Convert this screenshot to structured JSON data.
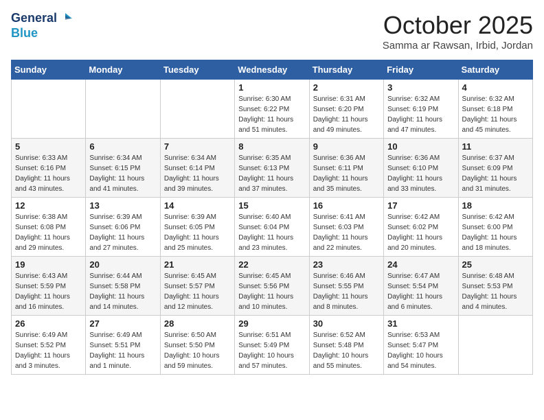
{
  "header": {
    "logo_line1": "General",
    "logo_line2": "Blue",
    "month_title": "October 2025",
    "location": "Samma ar Rawsan, Irbid, Jordan"
  },
  "weekdays": [
    "Sunday",
    "Monday",
    "Tuesday",
    "Wednesday",
    "Thursday",
    "Friday",
    "Saturday"
  ],
  "weeks": [
    [
      {
        "day": "",
        "info": ""
      },
      {
        "day": "",
        "info": ""
      },
      {
        "day": "",
        "info": ""
      },
      {
        "day": "1",
        "info": "Sunrise: 6:30 AM\nSunset: 6:22 PM\nDaylight: 11 hours\nand 51 minutes."
      },
      {
        "day": "2",
        "info": "Sunrise: 6:31 AM\nSunset: 6:20 PM\nDaylight: 11 hours\nand 49 minutes."
      },
      {
        "day": "3",
        "info": "Sunrise: 6:32 AM\nSunset: 6:19 PM\nDaylight: 11 hours\nand 47 minutes."
      },
      {
        "day": "4",
        "info": "Sunrise: 6:32 AM\nSunset: 6:18 PM\nDaylight: 11 hours\nand 45 minutes."
      }
    ],
    [
      {
        "day": "5",
        "info": "Sunrise: 6:33 AM\nSunset: 6:16 PM\nDaylight: 11 hours\nand 43 minutes."
      },
      {
        "day": "6",
        "info": "Sunrise: 6:34 AM\nSunset: 6:15 PM\nDaylight: 11 hours\nand 41 minutes."
      },
      {
        "day": "7",
        "info": "Sunrise: 6:34 AM\nSunset: 6:14 PM\nDaylight: 11 hours\nand 39 minutes."
      },
      {
        "day": "8",
        "info": "Sunrise: 6:35 AM\nSunset: 6:13 PM\nDaylight: 11 hours\nand 37 minutes."
      },
      {
        "day": "9",
        "info": "Sunrise: 6:36 AM\nSunset: 6:11 PM\nDaylight: 11 hours\nand 35 minutes."
      },
      {
        "day": "10",
        "info": "Sunrise: 6:36 AM\nSunset: 6:10 PM\nDaylight: 11 hours\nand 33 minutes."
      },
      {
        "day": "11",
        "info": "Sunrise: 6:37 AM\nSunset: 6:09 PM\nDaylight: 11 hours\nand 31 minutes."
      }
    ],
    [
      {
        "day": "12",
        "info": "Sunrise: 6:38 AM\nSunset: 6:08 PM\nDaylight: 11 hours\nand 29 minutes."
      },
      {
        "day": "13",
        "info": "Sunrise: 6:39 AM\nSunset: 6:06 PM\nDaylight: 11 hours\nand 27 minutes."
      },
      {
        "day": "14",
        "info": "Sunrise: 6:39 AM\nSunset: 6:05 PM\nDaylight: 11 hours\nand 25 minutes."
      },
      {
        "day": "15",
        "info": "Sunrise: 6:40 AM\nSunset: 6:04 PM\nDaylight: 11 hours\nand 23 minutes."
      },
      {
        "day": "16",
        "info": "Sunrise: 6:41 AM\nSunset: 6:03 PM\nDaylight: 11 hours\nand 22 minutes."
      },
      {
        "day": "17",
        "info": "Sunrise: 6:42 AM\nSunset: 6:02 PM\nDaylight: 11 hours\nand 20 minutes."
      },
      {
        "day": "18",
        "info": "Sunrise: 6:42 AM\nSunset: 6:00 PM\nDaylight: 11 hours\nand 18 minutes."
      }
    ],
    [
      {
        "day": "19",
        "info": "Sunrise: 6:43 AM\nSunset: 5:59 PM\nDaylight: 11 hours\nand 16 minutes."
      },
      {
        "day": "20",
        "info": "Sunrise: 6:44 AM\nSunset: 5:58 PM\nDaylight: 11 hours\nand 14 minutes."
      },
      {
        "day": "21",
        "info": "Sunrise: 6:45 AM\nSunset: 5:57 PM\nDaylight: 11 hours\nand 12 minutes."
      },
      {
        "day": "22",
        "info": "Sunrise: 6:45 AM\nSunset: 5:56 PM\nDaylight: 11 hours\nand 10 minutes."
      },
      {
        "day": "23",
        "info": "Sunrise: 6:46 AM\nSunset: 5:55 PM\nDaylight: 11 hours\nand 8 minutes."
      },
      {
        "day": "24",
        "info": "Sunrise: 6:47 AM\nSunset: 5:54 PM\nDaylight: 11 hours\nand 6 minutes."
      },
      {
        "day": "25",
        "info": "Sunrise: 6:48 AM\nSunset: 5:53 PM\nDaylight: 11 hours\nand 4 minutes."
      }
    ],
    [
      {
        "day": "26",
        "info": "Sunrise: 6:49 AM\nSunset: 5:52 PM\nDaylight: 11 hours\nand 3 minutes."
      },
      {
        "day": "27",
        "info": "Sunrise: 6:49 AM\nSunset: 5:51 PM\nDaylight: 11 hours\nand 1 minute."
      },
      {
        "day": "28",
        "info": "Sunrise: 6:50 AM\nSunset: 5:50 PM\nDaylight: 10 hours\nand 59 minutes."
      },
      {
        "day": "29",
        "info": "Sunrise: 6:51 AM\nSunset: 5:49 PM\nDaylight: 10 hours\nand 57 minutes."
      },
      {
        "day": "30",
        "info": "Sunrise: 6:52 AM\nSunset: 5:48 PM\nDaylight: 10 hours\nand 55 minutes."
      },
      {
        "day": "31",
        "info": "Sunrise: 6:53 AM\nSunset: 5:47 PM\nDaylight: 10 hours\nand 54 minutes."
      },
      {
        "day": "",
        "info": ""
      }
    ]
  ]
}
